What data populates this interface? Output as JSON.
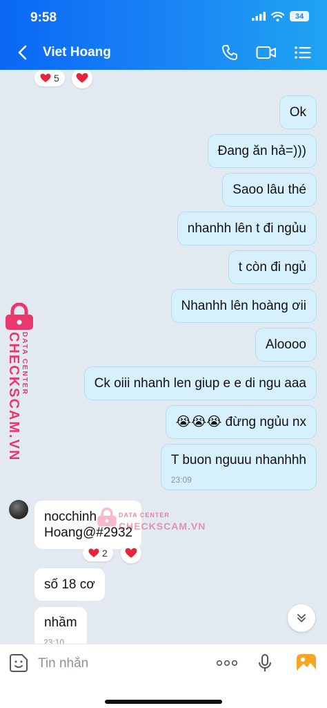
{
  "status_bar": {
    "time": "9:58",
    "battery": "34"
  },
  "header": {
    "title": "Viet Hoang"
  },
  "top_reaction": {
    "count": "5"
  },
  "outgoing": [
    {
      "text": "Ok"
    },
    {
      "text": "Đang ăn hả=)))"
    },
    {
      "text": "Saoo lâu thé"
    },
    {
      "text": "nhanhh lên t đi ngủu"
    },
    {
      "text": "t còn đi ngủ"
    },
    {
      "text": "Nhanhh lên hoàng ơii"
    },
    {
      "text": "Aloooo"
    },
    {
      "text": "Ck oiii nhanh len giup e e di ngu aaa"
    },
    {
      "text": "😭😭😭 đừng ngủu nx"
    },
    {
      "text": "T buon nguuu nhanhhh",
      "time": "23:09"
    }
  ],
  "incoming": [
    {
      "line1": "nocchinh",
      "line2": "Hoang@#2932",
      "reaction_count": "2"
    },
    {
      "text": "số 18 cơ"
    },
    {
      "text": "nhầm",
      "time": "23:10"
    }
  ],
  "watermark": {
    "brand": "CHECKSCAM.VN",
    "sub": "DATA CENTER"
  },
  "input": {
    "placeholder": "Tin nhắn"
  },
  "colors": {
    "header_start": "#0a68f5",
    "header_end": "#1fa4f2",
    "outgoing_bubble": "#d6f0fc",
    "incoming_bubble": "#ffffff",
    "chat_bg": "#e2e9f1",
    "watermark": "#e9386e",
    "heart": "#e8243c"
  }
}
